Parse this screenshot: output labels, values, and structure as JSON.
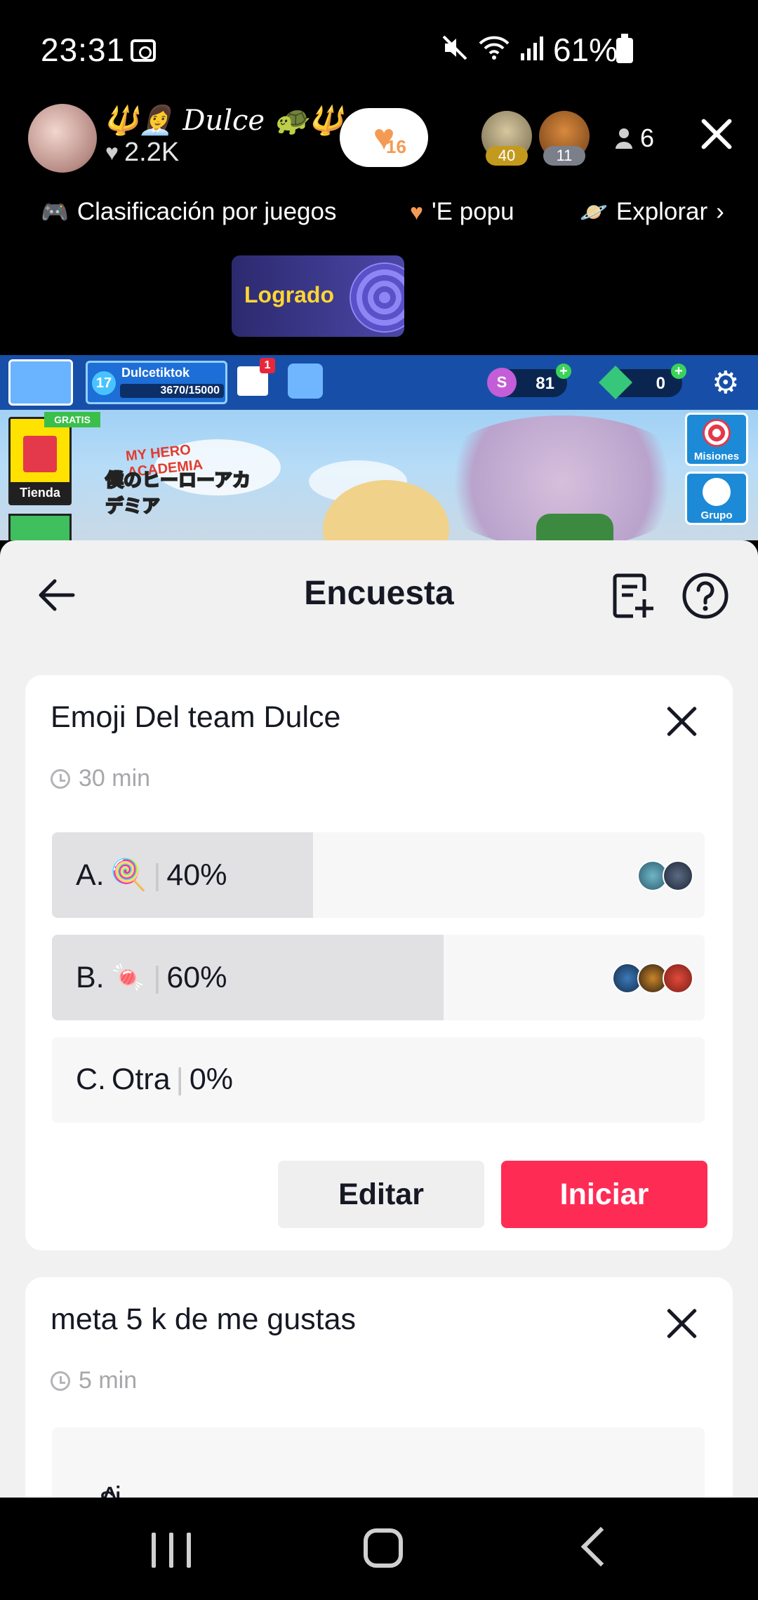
{
  "status_bar": {
    "time": "23:31",
    "battery": "61%"
  },
  "live": {
    "host_name": "🔱👩‍💼 Dulce 🐢🔱",
    "host_likes": "2.2K",
    "heart_count": "16",
    "viewers": [
      {
        "badge": "40"
      },
      {
        "badge": "11"
      }
    ],
    "viewer_count": "6",
    "chips": [
      {
        "icon": "gamepad-icon",
        "label": "Clasificación por juegos"
      },
      {
        "icon": "heart-icon",
        "label": "'E popu"
      },
      {
        "icon": "planet-icon",
        "label": "Explorar"
      }
    ],
    "achievement": "Logrado"
  },
  "game": {
    "player_name": "Dulcetiktok",
    "level": "17",
    "xp": "3670/15000",
    "news_badge": "1",
    "coins": "81",
    "gems": "0",
    "shop_free": "GRATIS",
    "shop_label": "Tienda",
    "missions_label": "Misiones",
    "group_label": "Grupo",
    "logo_top": "MY HERO ACADEMIA",
    "logo_bottom": "僕のヒーローアカデミア"
  },
  "poll_panel": {
    "title": "Encuesta",
    "polls": [
      {
        "title": "Emoji Del team Dulce",
        "duration": "30 min",
        "options": [
          {
            "letter": "A.",
            "emoji": "🍭",
            "percent": "40%",
            "fraction": 0.4
          },
          {
            "letter": "B.",
            "emoji": "🍬",
            "percent": "60%",
            "fraction": 0.6
          },
          {
            "letter": "C.",
            "text": "Otra",
            "percent": "0%",
            "fraction": 0
          }
        ],
        "edit_label": "Editar",
        "start_label": "Iniciar"
      },
      {
        "title": "meta 5 k de me gustas",
        "duration": "5 min",
        "options": [
          {
            "letter": "A.",
            "text": "si"
          }
        ]
      }
    ]
  },
  "colors": {
    "accent": "#fe2c55",
    "panel_bg": "#f1f1f2",
    "bar_fill": "#e1e1e3"
  }
}
